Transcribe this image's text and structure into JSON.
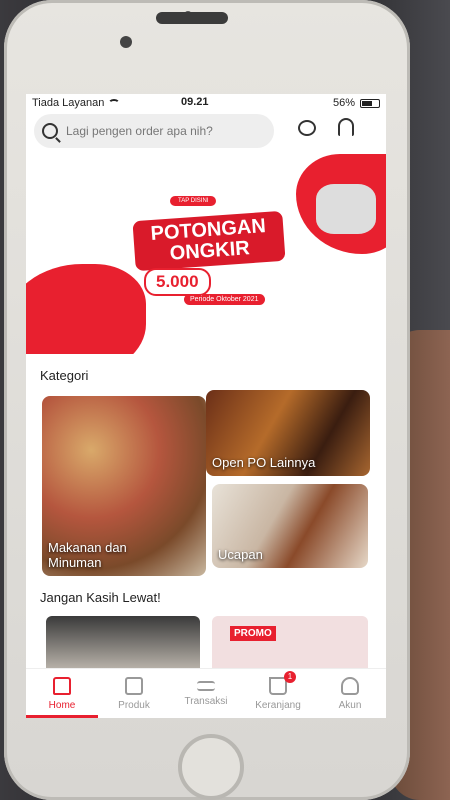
{
  "status": {
    "carrier": "Tiada Layanan",
    "time": "09.21",
    "battery": "56%"
  },
  "search": {
    "placeholder": "Lagi pengen order apa nih?"
  },
  "banner": {
    "tag": "TAP DISINI",
    "title": "POTONGAN ONGKIR",
    "amount": "5.000",
    "period": "Periode Oktober 2021",
    "dots_total": 6,
    "active_dot": 0
  },
  "kategori": {
    "title": "Kategori",
    "items": [
      {
        "label": "Makanan dan Minuman"
      },
      {
        "label": "Open PO Lainnya"
      },
      {
        "label": "Ucapan"
      }
    ]
  },
  "jangan": {
    "title": "Jangan Kasih Lewat!",
    "promo_label": "PROMO"
  },
  "tabs": [
    {
      "label": "Home",
      "icon": "home-icon",
      "active": true
    },
    {
      "label": "Produk",
      "icon": "store-icon"
    },
    {
      "label": "Transaksi",
      "icon": "swap-icon"
    },
    {
      "label": "Keranjang",
      "icon": "cart-icon",
      "badge": "1"
    },
    {
      "label": "Akun",
      "icon": "user-icon"
    }
  ],
  "colors": {
    "accent": "#e8202f"
  }
}
